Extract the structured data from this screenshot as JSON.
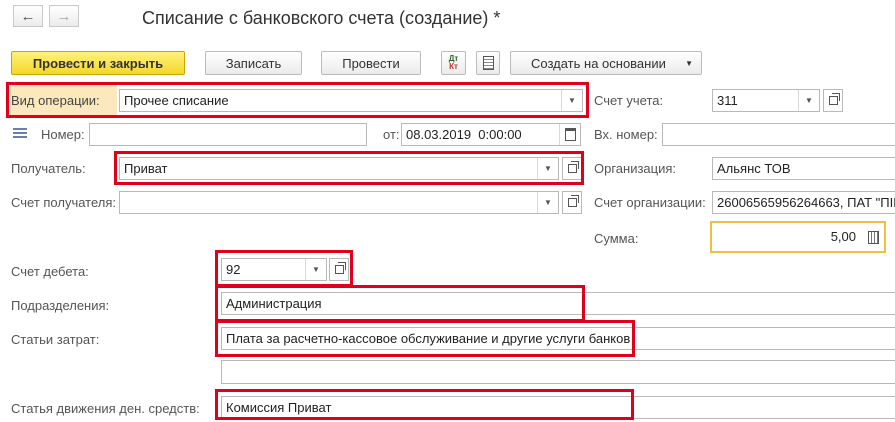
{
  "header": {
    "title": "Списание с банковского счета (создание) *",
    "back_icon": "←",
    "forward_icon": "→"
  },
  "toolbar": {
    "post_close": "Провести и закрыть",
    "save": "Записать",
    "post": "Провести",
    "dtkt_top": "Дт",
    "dtkt_bottom": "Кт",
    "create_based": "Создать на основании"
  },
  "form": {
    "operation_label": "Вид операции:",
    "operation_value": "Прочее списание",
    "account_label": "Счет учета:",
    "account_value": "311",
    "number_label": "Номер:",
    "number_value": "",
    "from_label": "от:",
    "date_value": "08.03.2019  0:00:00",
    "inc_number_label": "Вх. номер:",
    "inc_number_value": "",
    "recipient_label": "Получатель:",
    "recipient_value": "Приват",
    "organization_label": "Организация:",
    "organization_value": "Альянс ТОВ",
    "recipient_account_label": "Счет получателя:",
    "recipient_account_value": "",
    "org_account_label": "Счет организации:",
    "org_account_value": "26006565956264663, ПАТ \"ПІВ",
    "amount_label": "Сумма:",
    "amount_value": "5,00",
    "debit_account_label": "Счет дебета:",
    "debit_account_value": "92",
    "subdivision_label": "Подразделения:",
    "subdivision_value": "Администрация",
    "cost_items_label": "Статьи затрат:",
    "cost_items_value": "Плата за расчетно-кассовое обслуживание и другие услуги банков",
    "cashflow_label": "Статья движения ден. средств:",
    "cashflow_value": "Комиссия Приват"
  },
  "colors": {
    "highlight_box": "#e0001b",
    "primary_button": "#f4d72b",
    "amount_border": "#f0c040",
    "operation_label_bg": "#fbe9bd"
  }
}
